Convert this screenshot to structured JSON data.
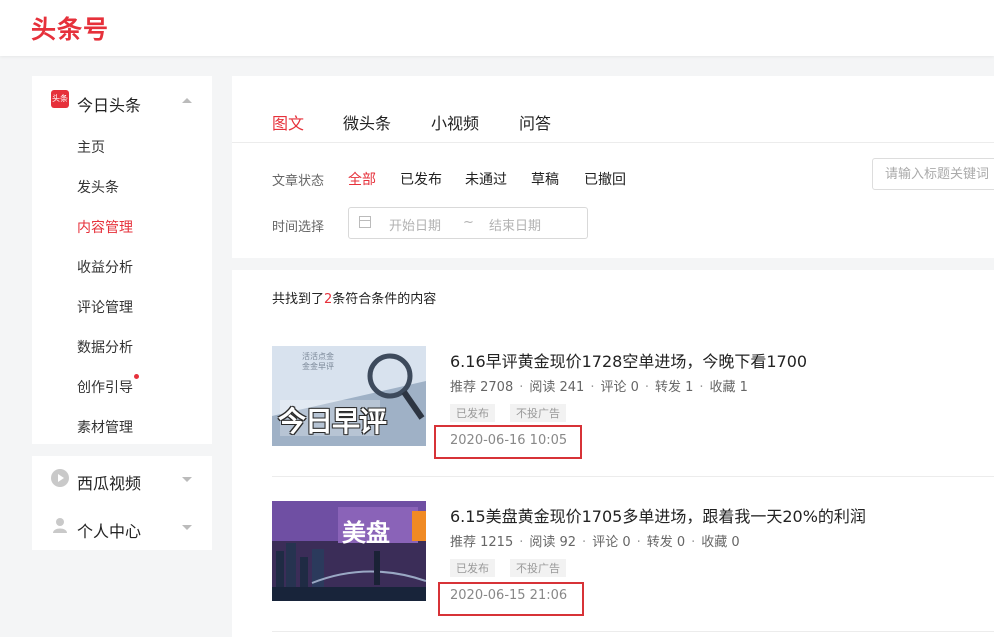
{
  "brand": {
    "logo": "头条号",
    "color": "#e6313b"
  },
  "sidebar": {
    "toutiao": {
      "icon": "toutiao-icon",
      "icon_text": "头条",
      "label": "今日头条",
      "items": [
        {
          "label": "主页"
        },
        {
          "label": "发头条"
        },
        {
          "label": "内容管理"
        },
        {
          "label": "收益分析"
        },
        {
          "label": "评论管理"
        },
        {
          "label": "数据分析"
        },
        {
          "label": "创作引导"
        },
        {
          "label": "素材管理"
        }
      ]
    },
    "xigua": {
      "icon": "play-icon",
      "label": "西瓜视频"
    },
    "personal": {
      "icon": "user-icon",
      "label": "个人中心"
    }
  },
  "tabs": [
    {
      "label": "图文"
    },
    {
      "label": "微头条"
    },
    {
      "label": "小视频"
    },
    {
      "label": "问答"
    }
  ],
  "filters": {
    "status_label": "文章状态",
    "status_options": [
      "全部",
      "已发布",
      "未通过",
      "草稿",
      "已撤回"
    ],
    "search_placeholder": "请输入标题关键词",
    "time_label": "时间选择",
    "start_placeholder": "开始日期",
    "range_sep": "~",
    "end_placeholder": "结束日期"
  },
  "results": {
    "prefix": "共找到了",
    "count": "2",
    "suffix": "条符合条件的内容"
  },
  "articles": [
    {
      "title": "6.16早评黄金现价1728空单进场，今晚下看1700",
      "recommend": "推荐 2708",
      "read": "阅读 241",
      "comment": "评论 0",
      "share": "转发 1",
      "favorite": "收藏 1",
      "status": "已发布",
      "ad": "不投广告",
      "time": "2020-06-16 10:05",
      "thumb_text": "今日早评",
      "thumb_small": "活活点金 金金早评"
    },
    {
      "title": "6.15美盘黄金现价1705多单进场，跟着我一天20%的利润",
      "recommend": "推荐 1215",
      "read": "阅读 92",
      "comment": "评论 0",
      "share": "转发 0",
      "favorite": "收藏 0",
      "status": "已发布",
      "ad": "不投广告",
      "time": "2020-06-15 21:06",
      "thumb_text": "美盘"
    }
  ],
  "stat_separator": "·"
}
